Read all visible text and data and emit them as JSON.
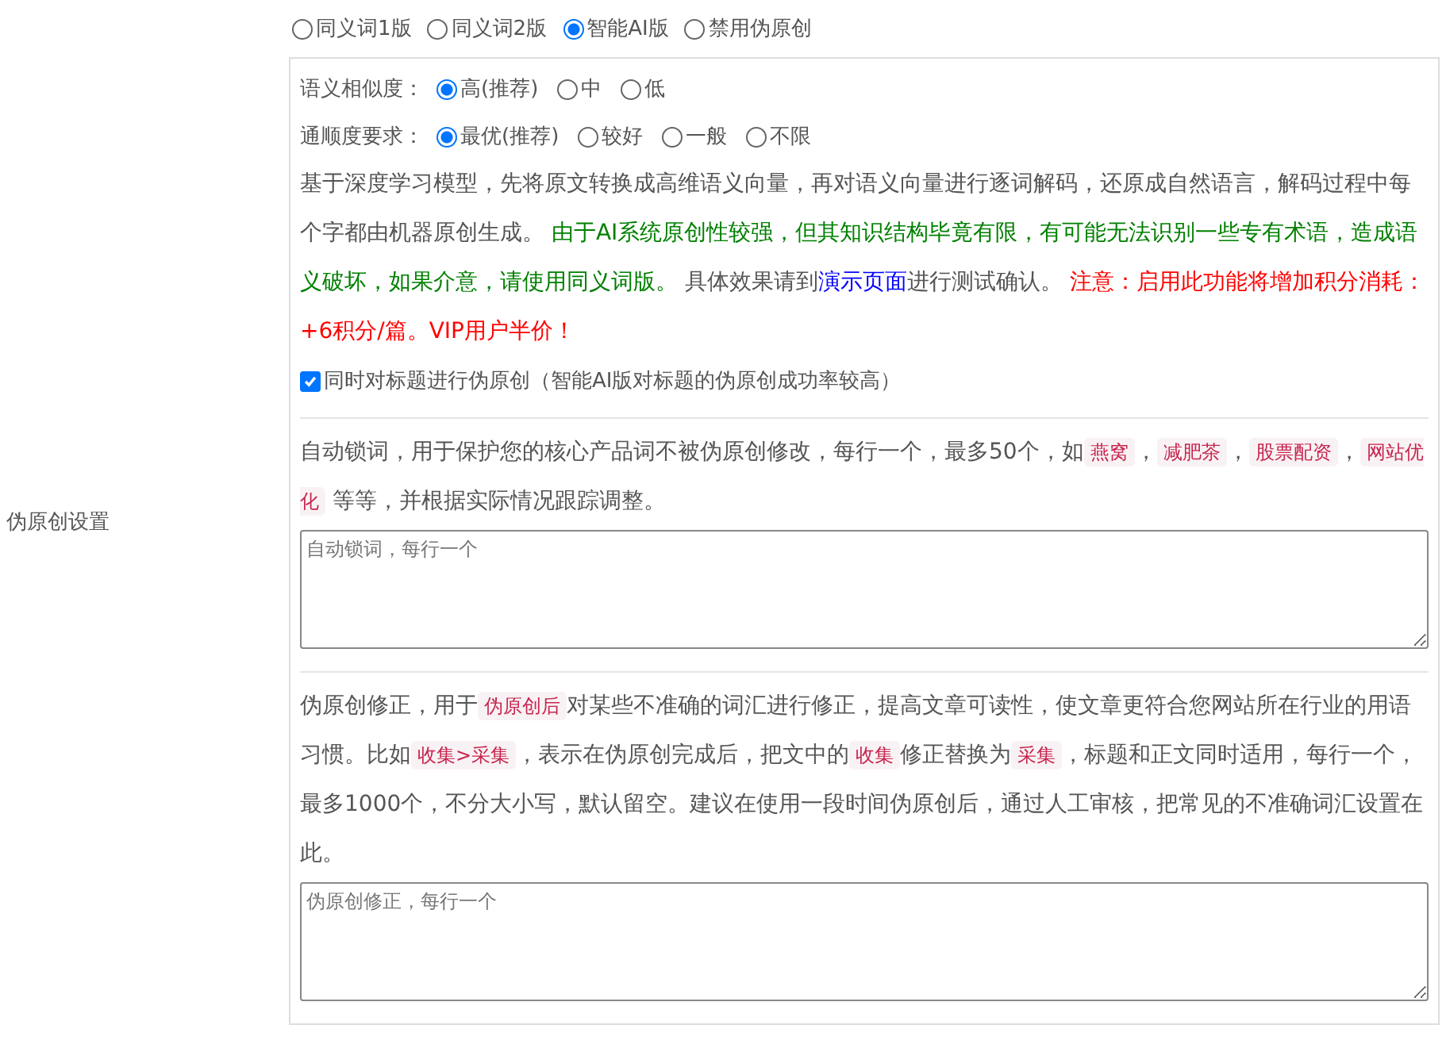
{
  "section_label": "伪原创设置",
  "modes": [
    {
      "label": "同义词1版",
      "selected": false
    },
    {
      "label": "同义词2版",
      "selected": false
    },
    {
      "label": "智能AI版",
      "selected": true
    },
    {
      "label": "禁用伪原创",
      "selected": false
    }
  ],
  "similarity": {
    "label": "语义相似度：",
    "options": [
      {
        "label": "高(推荐)",
        "selected": true
      },
      {
        "label": "中",
        "selected": false
      },
      {
        "label": "低",
        "selected": false
      }
    ]
  },
  "fluency": {
    "label": "通顺度要求：",
    "options": [
      {
        "label": "最优(推荐)",
        "selected": true
      },
      {
        "label": "较好",
        "selected": false
      },
      {
        "label": "一般",
        "selected": false
      },
      {
        "label": "不限",
        "selected": false
      }
    ]
  },
  "ai_description": [
    {
      "kind": "plain",
      "text": "基于深度学习模型，先将原文转换成高维语义向量，再对语义向量进行逐词解码，还原成自然语言，解码过程中每个字都由机器原创生成。 "
    },
    {
      "kind": "green",
      "text": "由于AI系统原创性较强，但其知识结构毕竟有限，有可能无法识别一些专有术语，造成语义破坏，如果介意，请使用同义词版。"
    },
    {
      "kind": "plain",
      "text": " 具体效果请到"
    },
    {
      "kind": "link",
      "text": "演示页面"
    },
    {
      "kind": "plain",
      "text": "进行测试确认。 "
    },
    {
      "kind": "red",
      "text": "注意：启用此功能将增加积分消耗：+6积分/篇。VIP用户半价！"
    }
  ],
  "title_option": {
    "label": "同时对标题进行伪原创（智能AI版对标题的伪原创成功率较高）",
    "checked": true
  },
  "lock_description": [
    {
      "kind": "plain",
      "text": "自动锁词，用于保护您的核心产品词不被伪原创修改，每行一个，最多50个，如"
    },
    {
      "kind": "tag",
      "text": "燕窝"
    },
    {
      "kind": "plain",
      "text": "，"
    },
    {
      "kind": "tag",
      "text": "减肥茶"
    },
    {
      "kind": "plain",
      "text": "，"
    },
    {
      "kind": "tag",
      "text": "股票配资"
    },
    {
      "kind": "plain",
      "text": "，"
    },
    {
      "kind": "tag",
      "text": "网站优化"
    },
    {
      "kind": "plain",
      "text": " 等等，并根据实际情况跟踪调整。"
    }
  ],
  "lock_field": {
    "placeholder": "自动锁词，每行一个"
  },
  "fix_description": [
    {
      "kind": "plain",
      "text": "伪原创修正，用于"
    },
    {
      "kind": "tag",
      "text": "伪原创后"
    },
    {
      "kind": "plain",
      "text": "对某些不准确的词汇进行修正，提高文章可读性，使文章更符合您网站所在行业的用语习惯。比如"
    },
    {
      "kind": "tag",
      "text": "收集>采集"
    },
    {
      "kind": "plain",
      "text": "，表示在伪原创完成后，把文中的"
    },
    {
      "kind": "tag",
      "text": "收集"
    },
    {
      "kind": "plain",
      "text": "修正替换为"
    },
    {
      "kind": "tag",
      "text": "采集"
    },
    {
      "kind": "plain",
      "text": "，标题和正文同时适用，每行一个，最多1000个，不分大小写，默认留空。建议在使用一段时间伪原创后，通过人工审核，把常见的不准确词汇设置在此。"
    }
  ],
  "fix_field": {
    "placeholder": "伪原创修正，每行一个"
  }
}
